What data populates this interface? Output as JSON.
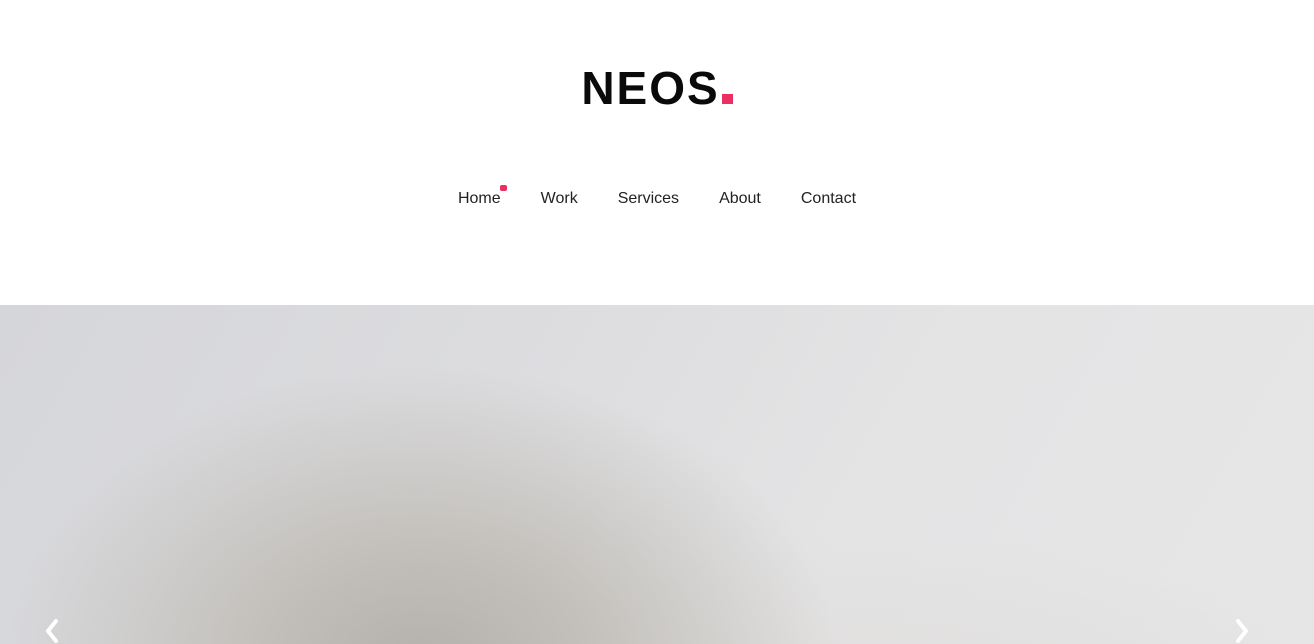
{
  "brand": {
    "name": "NEOS",
    "accent_color": "#ea2f63"
  },
  "nav": {
    "items": [
      {
        "label": "Home",
        "active": true
      },
      {
        "label": "Work",
        "active": false
      },
      {
        "label": "Services",
        "active": false
      },
      {
        "label": "About",
        "active": false
      },
      {
        "label": "Contact",
        "active": false
      }
    ]
  },
  "slider": {
    "prev_icon": "chevron-left-icon",
    "next_icon": "chevron-right-icon"
  }
}
